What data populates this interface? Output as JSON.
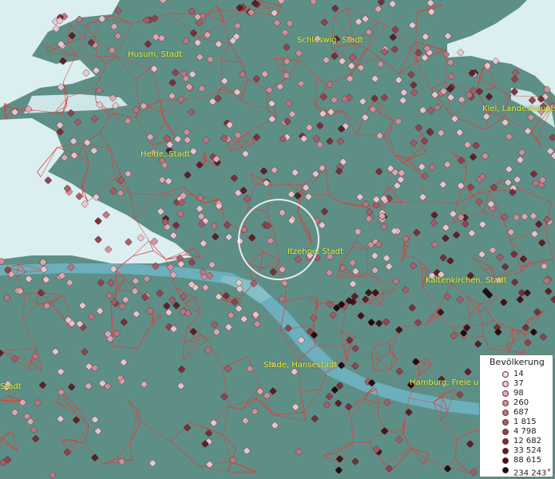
{
  "map": {
    "colors": {
      "land": "#5e8f86",
      "water": "#dbeff0",
      "river": "#6fb3c2",
      "boundary": "#e03c3c",
      "marker_outline": "#3c1c1c",
      "label_text": "#e8ee30"
    },
    "focus_circle": "selection-ring"
  },
  "places": {
    "husum": "Husum, Stadt",
    "schleswig": "Schleswig, Stadt",
    "kiel": "Kiel, Landeshaupts",
    "heide": "Heide, Stadt",
    "itzehoe": "Itzehoe, Stadt",
    "kaltenkirchen": "Kaltenkirchen, Stadt",
    "stade": "Stade, Hansestadt",
    "hamburg": "Hamburg, Freie u",
    "stadt_west": "Stadt"
  },
  "legend": {
    "title": "Bevölkerung",
    "items": [
      {
        "label": "14",
        "color": "#f7e1ea"
      },
      {
        "label": "37",
        "color": "#eec7d1"
      },
      {
        "label": "98",
        "color": "#e2a9b5"
      },
      {
        "label": "260",
        "color": "#d1909c"
      },
      {
        "label": "687",
        "color": "#bd7482"
      },
      {
        "label": "1 815",
        "color": "#a85a67"
      },
      {
        "label": "4 798",
        "color": "#90404d"
      },
      {
        "label": "12 682",
        "color": "#762d38"
      },
      {
        "label": "33 524",
        "color": "#5a1c24"
      },
      {
        "label": "88 615",
        "color": "#3f0f15"
      },
      {
        "label": "234 243",
        "color": "#220508"
      }
    ],
    "last_suffix": "+"
  }
}
